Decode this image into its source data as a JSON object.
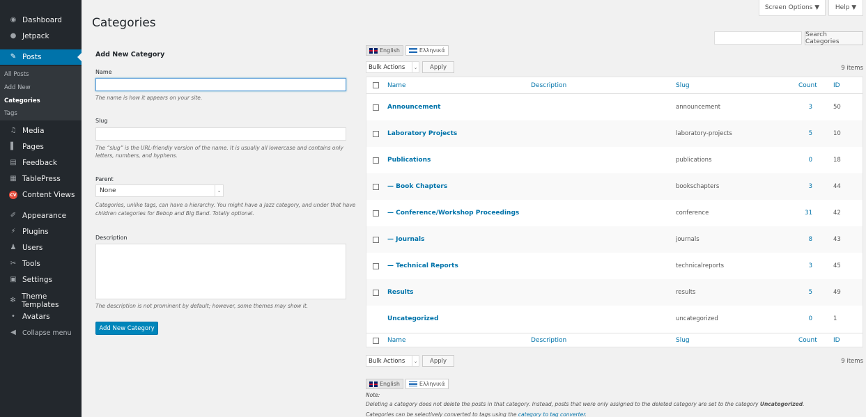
{
  "sidebar": {
    "items": [
      {
        "label": "Dashboard",
        "icon": "dashboard-icon"
      },
      {
        "label": "Jetpack",
        "icon": "jetpack-icon"
      },
      {
        "label": "Posts",
        "icon": "pin-icon"
      },
      {
        "label": "Media",
        "icon": "media-icon"
      },
      {
        "label": "Pages",
        "icon": "pages-icon"
      },
      {
        "label": "Feedback",
        "icon": "feedback-icon"
      },
      {
        "label": "TablePress",
        "icon": "table-icon"
      },
      {
        "label": "Content Views",
        "icon": "content-views-icon"
      },
      {
        "label": "Appearance",
        "icon": "paintbrush-icon"
      },
      {
        "label": "Plugins",
        "icon": "plugin-icon"
      },
      {
        "label": "Users",
        "icon": "users-icon"
      },
      {
        "label": "Tools",
        "icon": "wrench-icon"
      },
      {
        "label": "Settings",
        "icon": "settings-icon"
      },
      {
        "label": "Theme Templates",
        "icon": "gear-icon"
      },
      {
        "label": "Avatars",
        "icon": "avatar-icon"
      },
      {
        "label": "Collapse menu",
        "icon": "collapse-icon"
      }
    ],
    "submenu": [
      "All Posts",
      "Add New",
      "Categories",
      "Tags"
    ],
    "content_views_badge": "CV"
  },
  "header": {
    "screen_options": "Screen Options ▼",
    "help": "Help ▼",
    "title": "Categories"
  },
  "search": {
    "button": "Search Categories"
  },
  "form": {
    "heading": "Add New Category",
    "name_label": "Name",
    "name_hint": "The name is how it appears on your site.",
    "slug_label": "Slug",
    "slug_hint_1": "The “slug” is the URL-friendly version of the name. It is usually all lowercase and contains only",
    "slug_hint_2": "letters, numbers, and hyphens.",
    "parent_label": "Parent",
    "parent_value": "None",
    "parent_hint_1": "Categories, unlike tags, can have a hierarchy. You might have a Jazz category, and under that have",
    "parent_hint_2": "children categories for Bebop and Big Band. Totally optional.",
    "description_label": "Description",
    "description_hint": "The description is not prominent by default; however, some themes may show it.",
    "submit": "Add New Category"
  },
  "languages": [
    "English",
    "Ελληνικά"
  ],
  "bulk": {
    "select": "Bulk Actions",
    "apply": "Apply",
    "items": "9 items"
  },
  "table": {
    "columns": {
      "name": "Name",
      "description": "Description",
      "slug": "Slug",
      "count": "Count",
      "id": "ID"
    },
    "rows": [
      {
        "name": "Announcement",
        "slug": "announcement",
        "count": "3",
        "id": "50"
      },
      {
        "name": "Laboratory Projects",
        "slug": "laboratory-projects",
        "count": "5",
        "id": "10"
      },
      {
        "name": "Publications",
        "slug": "publications",
        "count": "0",
        "id": "18"
      },
      {
        "name": "— Book Chapters",
        "slug": "bookschapters",
        "count": "3",
        "id": "44"
      },
      {
        "name": "— Conference/Workshop Proceedings",
        "slug": "conference",
        "count": "31",
        "id": "42"
      },
      {
        "name": "— Journals",
        "slug": "journals",
        "count": "8",
        "id": "43"
      },
      {
        "name": "— Technical Reports",
        "slug": "technicalreports",
        "count": "3",
        "id": "45"
      },
      {
        "name": "Results",
        "slug": "results",
        "count": "5",
        "id": "49"
      },
      {
        "name": "Uncategorized",
        "slug": "uncategorized",
        "count": "0",
        "id": "1"
      }
    ]
  },
  "note": {
    "title": "Note:",
    "line1_pre": "Deleting a category does not delete the posts in that category. Instead, posts that were only assigned to the deleted category are set to the category ",
    "line1_bold": "Uncategorized",
    "line1_post": ".",
    "line2_pre": "Categories can be selectively converted to tags using the ",
    "line2_link": "category to tag converter",
    "line2_post": "."
  }
}
